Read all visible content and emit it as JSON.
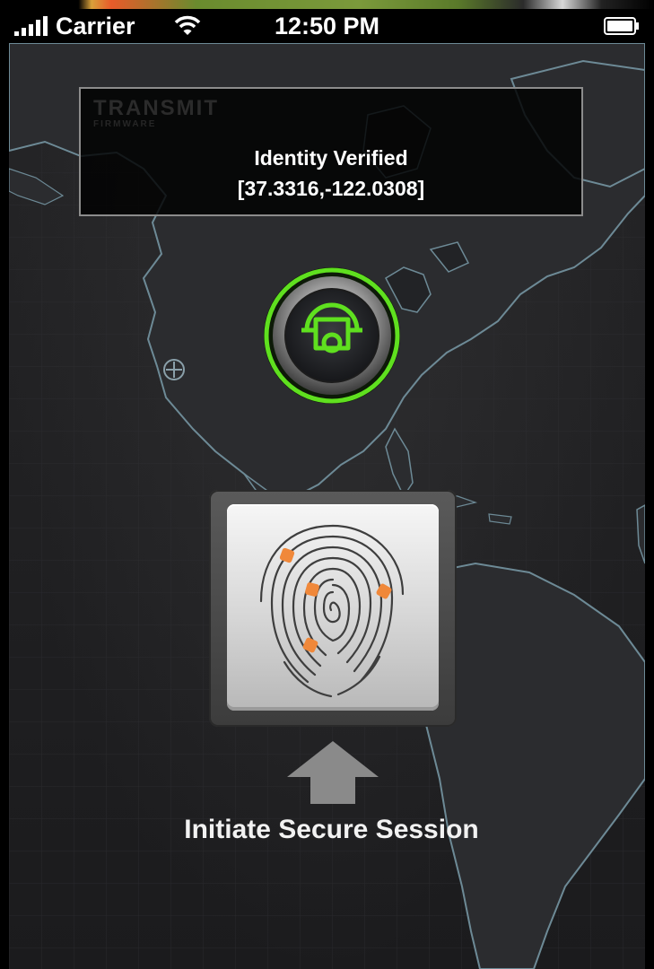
{
  "status_bar": {
    "carrier": "Carrier",
    "time": "12:50 PM"
  },
  "identity_panel": {
    "brand": "TRANSMIT",
    "brand_sub": "FIRMWARE",
    "status": "Identity Verified",
    "coordinates": "[37.3316,-122.0308]"
  },
  "action": {
    "label": "Initiate Secure Session"
  },
  "colors": {
    "accent_green": "#5fe01f",
    "fingerprint_dot": "#f0883a",
    "map_land_outline": "#6d8a96"
  },
  "icons": {
    "status": [
      "signal-icon",
      "wifi-icon",
      "battery-icon"
    ],
    "center": "device-lock-icon",
    "touch": "fingerprint-icon",
    "arrow": "arrow-up-icon",
    "map_marker": "crosshair-icon"
  }
}
